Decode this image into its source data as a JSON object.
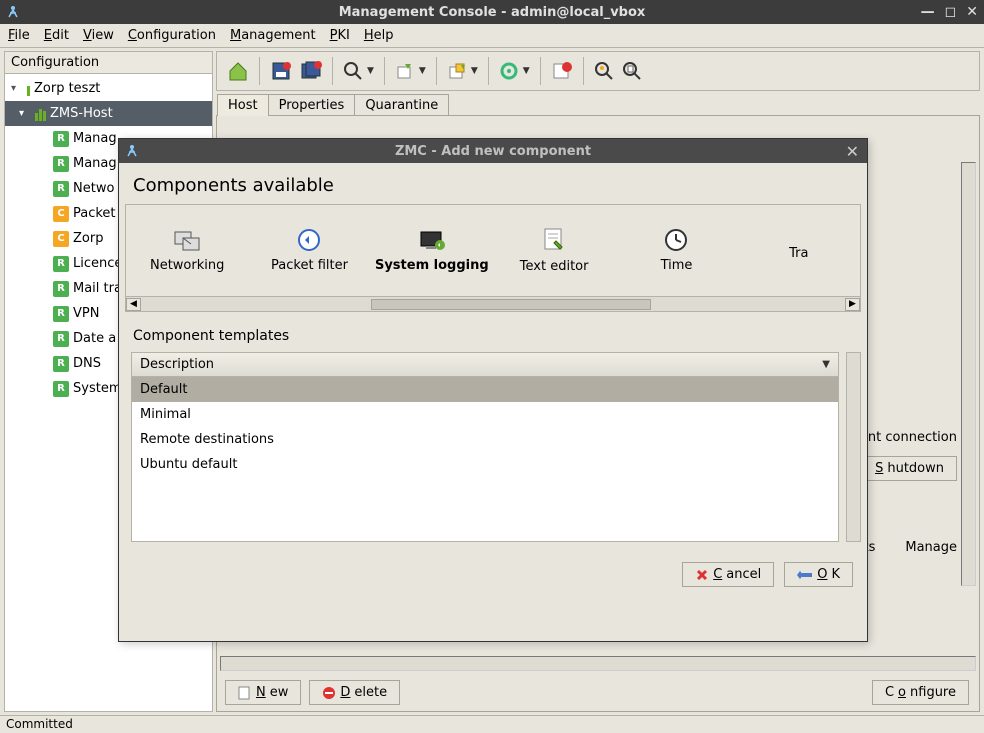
{
  "window": {
    "title": "Management Console - admin@local_vbox",
    "menu": [
      "File",
      "Edit",
      "View",
      "Configuration",
      "Management",
      "PKI",
      "Help"
    ],
    "status": "Committed"
  },
  "sidebar": {
    "title": "Configuration",
    "root": "Zorp teszt",
    "host": "ZMS-Host",
    "items": [
      {
        "label": "Manag",
        "icon": "r"
      },
      {
        "label": "Manag",
        "icon": "r"
      },
      {
        "label": "Netwo",
        "icon": "r"
      },
      {
        "label": "Packet",
        "icon": "c"
      },
      {
        "label": "Zorp",
        "icon": "c"
      },
      {
        "label": "Licence",
        "icon": "r"
      },
      {
        "label": "Mail tra",
        "icon": "r"
      },
      {
        "label": "VPN",
        "icon": "r"
      },
      {
        "label": "Date a",
        "icon": "r"
      },
      {
        "label": "DNS",
        "icon": "r"
      },
      {
        "label": "System",
        "icon": "r"
      }
    ]
  },
  "tabs": [
    "Host",
    "Properties",
    "Quarantine"
  ],
  "labels": {
    "conn": "ement connection",
    "shutdown": "Shutdown",
    "agents": "gents",
    "manage": "Manage",
    "new": "New",
    "delete": "Delete",
    "configure": "Configure"
  },
  "modal": {
    "title": "ZMC - Add new component",
    "heading": "Components available",
    "templates_heading": "Component templates",
    "components": [
      {
        "name": "Networking",
        "icon": "net"
      },
      {
        "name": "Packet filter",
        "icon": "pf"
      },
      {
        "name": "System logging",
        "icon": "syslog",
        "selected": true
      },
      {
        "name": "Text editor",
        "icon": "editor"
      },
      {
        "name": "Time",
        "icon": "clock"
      },
      {
        "name": "Tra",
        "icon": "partial"
      }
    ],
    "desc_header": "Description",
    "templates": [
      "Default",
      "Minimal",
      "Remote destinations",
      "Ubuntu default"
    ],
    "selected_template": "Default",
    "cancel": "Cancel",
    "ok": "OK"
  }
}
